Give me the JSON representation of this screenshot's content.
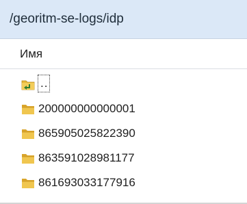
{
  "path": "/georitm-se-logs/idp",
  "column_header": "Имя",
  "parent_entry": {
    "label": "..",
    "icon": "folder-up-icon"
  },
  "folders": [
    {
      "name": "200000000000001",
      "icon": "folder-icon"
    },
    {
      "name": "865905025822390",
      "icon": "folder-icon"
    },
    {
      "name": "863591028981177",
      "icon": "folder-icon"
    },
    {
      "name": "861693033177916",
      "icon": "folder-icon"
    }
  ],
  "colors": {
    "path_bar": "#dbe8f7",
    "folder_yellow": "#e8b93a",
    "up_arrow_green": "#2f7d2f"
  }
}
